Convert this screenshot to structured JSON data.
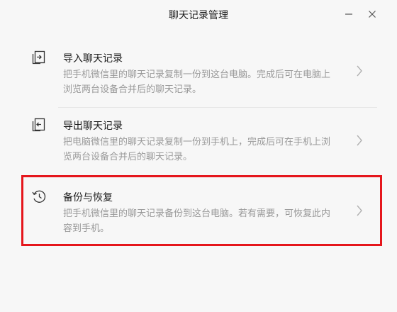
{
  "window": {
    "title": "聊天记录管理",
    "controls": {
      "minimize_icon": "minimize-icon",
      "close_icon": "close-icon"
    }
  },
  "items": [
    {
      "title": "导入聊天记录",
      "description": "把手机微信里的聊天记录复制一份到这台电脑。完成后可在电脑上浏览两台设备合并后的聊天记录。",
      "icon": "import-icon"
    },
    {
      "title": "导出聊天记录",
      "description": "把电脑微信里的聊天记录复制一份到手机上，完成后可在手机上浏览两台设备合并后的聊天记录。",
      "icon": "export-icon"
    },
    {
      "title": "备份与恢复",
      "description": "把手机微信里的聊天记录备份到这台电脑。若有需要，可恢复此内容到手机。",
      "icon": "history-icon"
    }
  ],
  "colors": {
    "background": "#f7f7f7",
    "title_text": "#1a1a1a",
    "description_text": "#999999",
    "highlight_border": "#e5161c"
  }
}
